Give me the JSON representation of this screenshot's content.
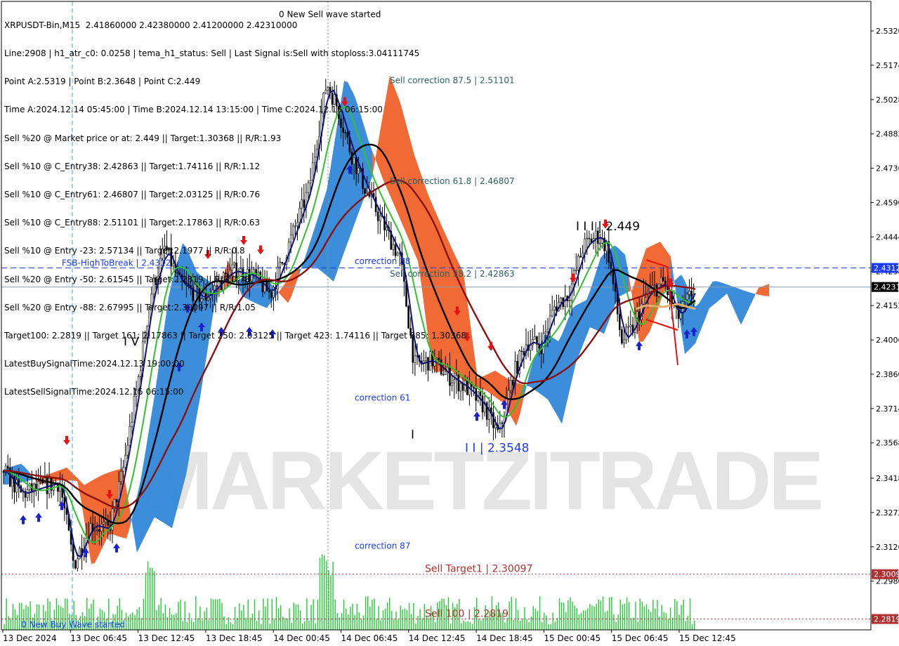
{
  "header": {
    "lines": [
      "XRPUSDT-Bin,M15  2.41860000 2.42380000 2.41200000 2.42310000",
      "Line:2908 | h1_atr_c0: 0.0258 | tema_h1_status: Sell | Last Signal is:Sell with stoploss:3.04111745",
      "Point A:2.5319 | Point B:2.3648 | Point C:2.449",
      "Time A:2024.12.14 05:45:00 | Time B:2024.12.14 13:15:00 | Time C:2024.12.15 06:15:00",
      "Sell %20 @ Market price or at: 2.449 || Target:1.30368 || R/R:1.93",
      "Sell %10 @ C_Entry38: 2.42863 || Target:1.74116 || R/R:1.12",
      "Sell %10 @ C_Entry61: 2.46807 || Target:2.03125 || R/R:0.76",
      "Sell %10 @ C_Entry88: 2.51101 || Target:2.17863 || R/R:0.63",
      "Sell %10 @ Entry -23: 2.57134 || Target:2.1977 || R/R:0.8",
      "Sell %20 @ Entry -50: 2.61545 || Target:2.2819 || R/R:0.78",
      "Sell %20 @ Entry -88: 2.67995 || Target:2.30097 || R/R:1.05",
      "Target100: 2.2819 || Target 161: 2.17863 || Target 250: 2.03125 || Target 423: 1.74116 || Target 685: 1.30368",
      "LatestBuySignalTime:2024.12.13 19:00:00",
      "LatestSellSignalTime:2024.12.15 06:15:00"
    ]
  },
  "chart_data": {
    "type": "candlestick",
    "symbol": "XRPUSDT-Bin",
    "timeframe": "M15",
    "ylim": [
      2.27,
      2.545
    ],
    "y_ticks": [
      "2.5320",
      "2.5174",
      "2.5028",
      "2.4882",
      "2.4736",
      "2.4590",
      "2.4444",
      "2.4298",
      "2.4152",
      "2.4006",
      "2.3860",
      "2.3714",
      "2.3568",
      "2.3418",
      "2.3272",
      "2.3126",
      "2.2980"
    ],
    "x_ticks": [
      "13 Dec 2024",
      "13 Dec 06:45",
      "13 Dec 12:45",
      "13 Dec 18:45",
      "14 Dec 00:45",
      "14 Dec 06:45",
      "14 Dec 12:45",
      "14 Dec 18:45",
      "15 Dec 00:45",
      "15 Dec 06:45",
      "15 Dec 12:45"
    ],
    "price_tags": [
      {
        "label": "2.4312",
        "value": 2.4312,
        "color": "#1a3aff"
      },
      {
        "label": "2.4231",
        "value": 2.4231,
        "color": "#000000"
      },
      {
        "label": "2.3009",
        "value": 2.30097,
        "color": "#b03030"
      },
      {
        "label": "2.2819",
        "value": 2.2819,
        "color": "#b03030"
      }
    ],
    "horizontal_lines": [
      {
        "value": 2.4312,
        "label": "FSB-HighToBreak | 2.4312",
        "color": "#1a3aff",
        "style": "dashed"
      },
      {
        "value": 2.4231,
        "label": "",
        "color": "#8899aa",
        "style": "solid"
      },
      {
        "value": 2.30097,
        "label": "Sell Target1 | 2.30097",
        "color": "#b03030",
        "style": "dotted"
      },
      {
        "value": 2.2819,
        "label": "Sell 100 | 2.2819",
        "color": "#b03030",
        "style": "dotted"
      }
    ],
    "annotations": [
      {
        "text": "Sell correction 87.5 | 2.51101",
        "value": 2.51101,
        "color": "#2a6060"
      },
      {
        "text": "Sell correction 61.8 | 2.46807",
        "value": 2.46807,
        "color": "#2a6060"
      },
      {
        "text": "Sell correction 38.2 | 2.42863",
        "value": 2.42863,
        "color": "#2a6060"
      },
      {
        "text": "correction 38",
        "value": 2.434,
        "color": "#1a3aff"
      },
      {
        "text": "correction 61",
        "value": 2.376,
        "color": "#1a3aff"
      },
      {
        "text": "correction 87",
        "value": 2.313,
        "color": "#1a3aff"
      },
      {
        "text": "0 New Sell wave started",
        "value": 2.539,
        "color": "#000000"
      },
      {
        "text": "0 New Buy Wave started",
        "value": 2.2795,
        "color": "#1a3aff"
      }
    ],
    "wave_labels": [
      {
        "text": "I V",
        "value": 2.4,
        "color": "#000000"
      },
      {
        "text": "I",
        "value": 2.3605,
        "color": "#000000"
      },
      {
        "text": "I I | 2.3548",
        "value": 2.3548,
        "color": "#1a3aff"
      },
      {
        "text": "I I I | 2.449",
        "value": 2.449,
        "color": "#000000"
      }
    ],
    "watermark": "MARKETZITRADE",
    "series": [
      {
        "name": "close",
        "role": "candles"
      },
      {
        "name": "",
        "role": "ma-fast",
        "color": "#10107a"
      },
      {
        "name": "",
        "role": "ma-mid",
        "color": "#30c030"
      },
      {
        "name": "",
        "role": "ma-slow",
        "color": "#000000"
      },
      {
        "name": "",
        "role": "ma-long",
        "color": "#8b1010"
      }
    ],
    "key_points": [
      {
        "label": "A",
        "time": "2024.12.14 05:45:00",
        "value": 2.5319
      },
      {
        "label": "B",
        "time": "2024.12.14 13:15:00",
        "value": 2.3648
      },
      {
        "label": "C",
        "time": "2024.12.15 06:15:00",
        "value": 2.449
      }
    ]
  }
}
